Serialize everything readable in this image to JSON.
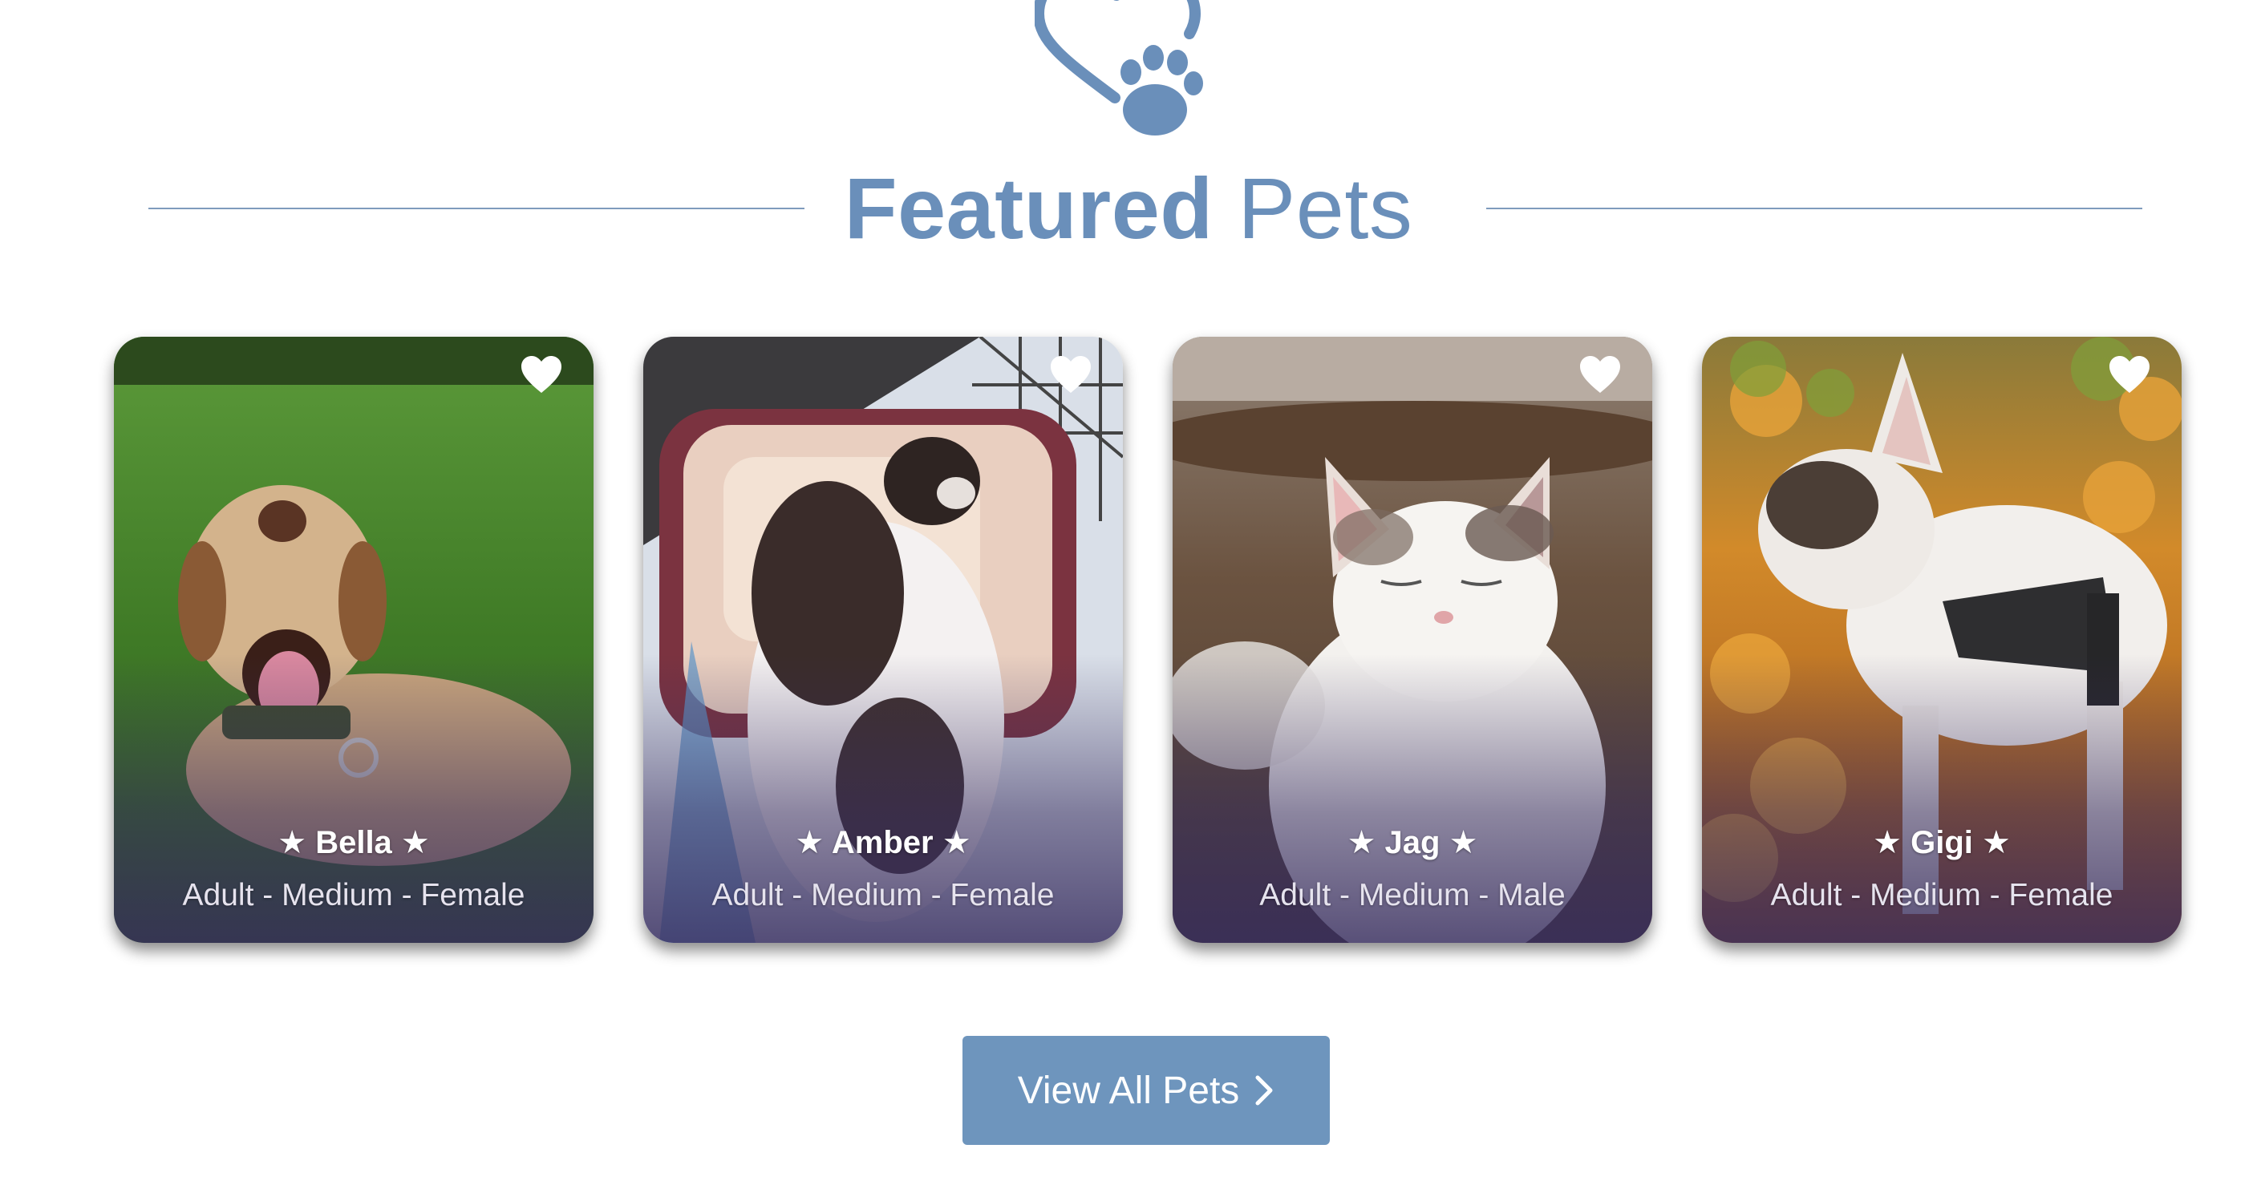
{
  "section": {
    "title_bold": "Featured",
    "title_light": "Pets",
    "accent_color": "#6a8fba",
    "logo_icon": "heart-paw-icon"
  },
  "pets": [
    {
      "name": "★ Bella ★",
      "details": "Adult - Medium - Female",
      "favorite_icon": "heart-icon"
    },
    {
      "name": "★ Amber ★",
      "details": "Adult - Medium - Female",
      "favorite_icon": "heart-icon"
    },
    {
      "name": "★ Jag ★",
      "details": "Adult - Medium - Male",
      "favorite_icon": "heart-icon"
    },
    {
      "name": "★ Gigi ★",
      "details": "Adult - Medium - Female",
      "favorite_icon": "heart-icon"
    }
  ],
  "cta": {
    "label": "View All Pets",
    "icon": "chevron-right-icon",
    "color": "#6e95bd"
  }
}
